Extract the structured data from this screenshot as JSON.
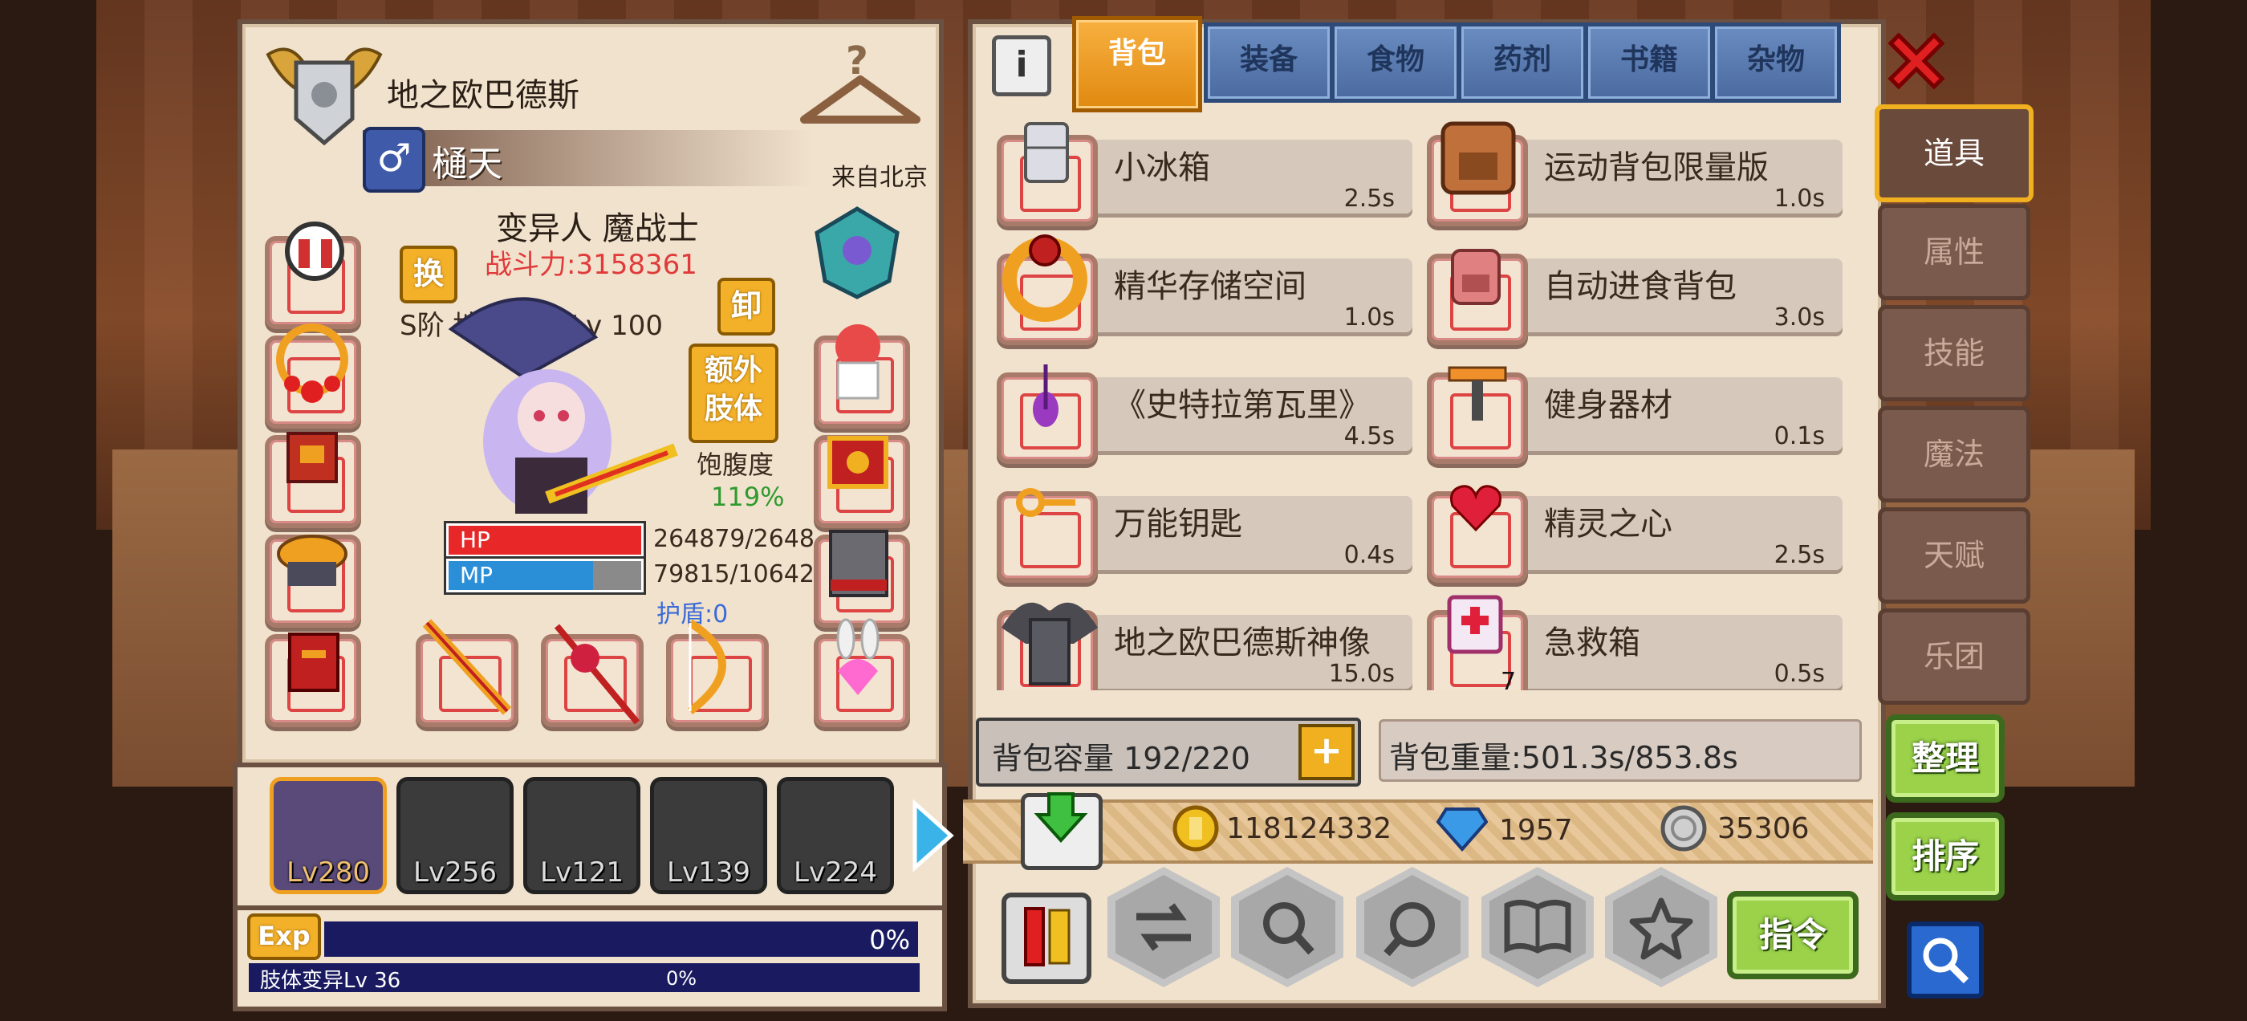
{
  "character": {
    "title": "地之欧巴德斯",
    "name": "樋天",
    "origin": "来自北京",
    "race_class": "变异人 魔战士",
    "power": "战斗力:3158361",
    "rank": "S阶 地狱使徒 Lv 100",
    "swap_label": "换",
    "unequip_label": "卸",
    "extra_limb_label": "额外\n肢体",
    "satiety_label": "饱腹度",
    "satiety_value": "119%",
    "hp_label": "HP",
    "hp_value": "264879/2648",
    "hp_fill": 1.0,
    "mp_label": "MP",
    "mp_value": "79815/10642",
    "mp_fill": 0.75,
    "shield": "护盾:0"
  },
  "party": [
    {
      "level": "Lv280"
    },
    {
      "level": "Lv256"
    },
    {
      "level": "Lv121"
    },
    {
      "level": "Lv139"
    },
    {
      "level": "Lv224"
    }
  ],
  "exp": {
    "label": "Exp",
    "percent": "0%",
    "limb_label": "肢体变异Lv 36",
    "limb_percent": "0%"
  },
  "tabs": [
    "背包",
    "装备",
    "食物",
    "药剂",
    "书籍",
    "杂物"
  ],
  "side_tabs": [
    "道具",
    "属性",
    "技能",
    "魔法",
    "天赋",
    "乐团"
  ],
  "items": [
    {
      "name": "小冰箱",
      "time": "2.5s"
    },
    {
      "name": "运动背包限量版",
      "time": "1.0s"
    },
    {
      "name": "精华存储空间",
      "time": "1.0s"
    },
    {
      "name": "自动进食背包",
      "time": "3.0s"
    },
    {
      "name": "《史特拉第瓦里》",
      "time": "4.5s"
    },
    {
      "name": "健身器材",
      "time": "0.1s"
    },
    {
      "name": "万能钥匙",
      "time": "0.4s"
    },
    {
      "name": "精灵之心",
      "time": "2.5s"
    },
    {
      "name": "地之欧巴德斯神像",
      "time": "15.0s"
    },
    {
      "name": "急救箱",
      "time": "0.5s",
      "count": "7"
    }
  ],
  "bag": {
    "capacity": "背包容量 192/220",
    "weight": "背包重量:501.3s/853.8s"
  },
  "currency": {
    "gold": "118124332",
    "diamond": "1957",
    "silver": "35306"
  },
  "buttons": {
    "sort": "整理",
    "order": "排序",
    "command": "指令"
  },
  "colors": {
    "active_tab": "#e8961c",
    "tab": "#5577aa",
    "green_button": "#9bd24a",
    "close": "#e02020"
  }
}
